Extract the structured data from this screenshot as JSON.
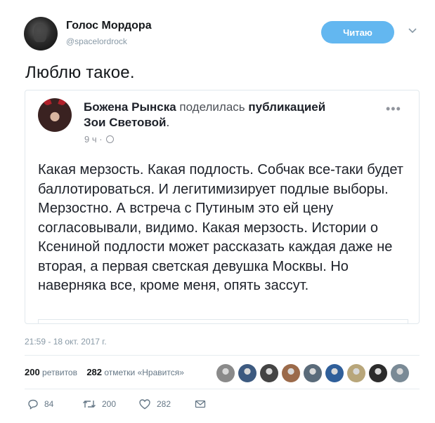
{
  "author": {
    "name": "Голос Мордора",
    "handle": "@spacelordrock",
    "follow_label": "Читаю"
  },
  "tweet": {
    "text": "Люблю такое."
  },
  "embedded_post": {
    "author": "Божена Рынска",
    "action": "поделилась",
    "object": "публикацией",
    "target": "Зои Световой",
    "time": "9 ч",
    "body": "Какая мерзость. Какая подлость. Собчак все-таки будет баллотироваться. И легитимизирует подлые выборы. Мерзостно. А встреча с Путиным это ей цену согласовывали, видимо. Какая мерзость. Истории о Ксениной подлости может рассказать каждая даже не вторая, а первая светская девушка Москвы. Но наверняка все, кроме меня, опять зассут."
  },
  "meta": {
    "timestamp": "21:59 - 18 окт. 2017 г."
  },
  "stats": {
    "retweets_count": "200",
    "retweets_label": "ретвитов",
    "likes_count": "282",
    "likes_label": "отметки «Нравится»"
  },
  "likers": [
    {
      "icon": "liker-avatar-1",
      "color": "#8a8a8a"
    },
    {
      "icon": "liker-avatar-2",
      "color": "#3d5a80"
    },
    {
      "icon": "liker-avatar-3",
      "color": "#444444"
    },
    {
      "icon": "liker-avatar-4",
      "color": "#9b6a4a"
    },
    {
      "icon": "liker-avatar-5",
      "color": "#5a6b7a"
    },
    {
      "icon": "liker-avatar-6",
      "color": "#2f5f9a"
    },
    {
      "icon": "liker-avatar-7",
      "color": "#b8a67a"
    },
    {
      "icon": "liker-avatar-8",
      "color": "#2c2c2c"
    },
    {
      "icon": "liker-avatar-9",
      "color": "#7a8a96"
    }
  ],
  "actions": {
    "replies": "84",
    "retweets": "200",
    "likes": "282"
  },
  "colors": {
    "accent": "#63b7f0",
    "muted": "#657786"
  }
}
